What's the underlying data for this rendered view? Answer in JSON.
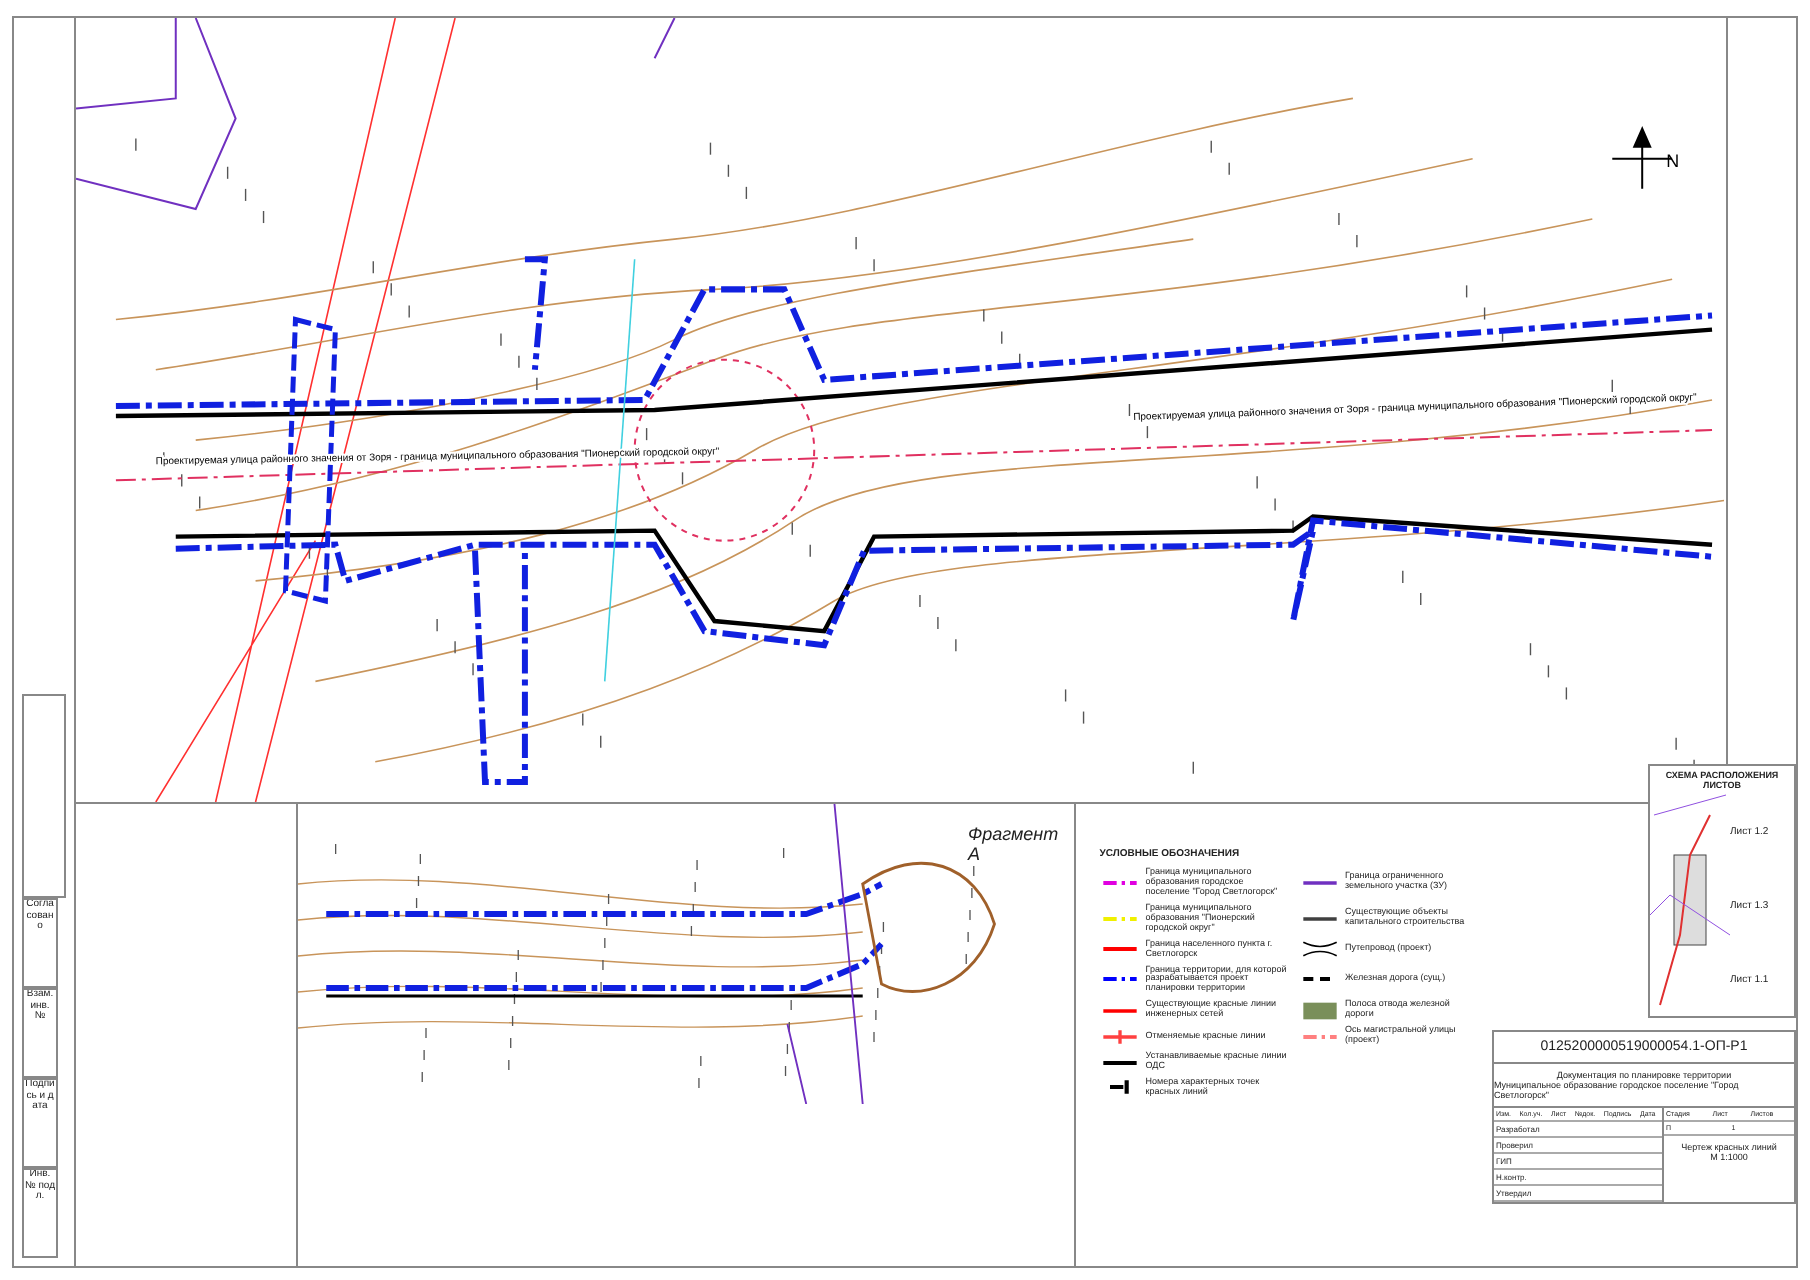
{
  "plan": {
    "north_label": "N",
    "street_label": "Проектируемая улица районного значения от Зоря - граница муниципального образования \"Пионерский городской округ\"",
    "street_label_left": "Проектируемая улица районного значения от Зоря - граница муниципального образования \"Пионерский городской округ\""
  },
  "fragment": {
    "title": "Фрагмент А"
  },
  "legend": {
    "title": "УСЛОВНЫЕ ОБОЗНАЧЕНИЯ",
    "items": [
      {
        "label": "Граница муниципального образования городское поселение \"Город Светлогорск\"",
        "kind": "dash",
        "color": "#e000e0"
      },
      {
        "label": "Граница муниципального образования \"Пионерский городской округ\"",
        "kind": "dash",
        "color": "#f0f000"
      },
      {
        "label": "Граница населенного пункта г. Светлогорск",
        "kind": "solid",
        "color": "#ff0000"
      },
      {
        "label": "Граница территории, для которой разрабатывается проект планировки территории",
        "kind": "dash",
        "color": "#0000ff"
      },
      {
        "label": "Существующие красные линии инженерных сетей",
        "kind": "thin",
        "color": "#ff0000"
      },
      {
        "label": "Отменяемые красные линии",
        "kind": "cross",
        "color": "#ff4040"
      },
      {
        "label": "Устанавливаемые красные линии ОДС",
        "kind": "solid",
        "color": "#000000"
      },
      {
        "label": "Номера характерных точек красных линий",
        "kind": "marker",
        "color": "#000000"
      },
      {
        "label": "Граница ограниченного земельного участка (ЗУ)",
        "kind": "thin",
        "color": "#7030c0"
      },
      {
        "label": "Существующие объекты капитального строительства",
        "kind": "thin",
        "color": "#404040"
      },
      {
        "label": "Путепровод (проект)",
        "kind": "bracket",
        "color": "#000000"
      },
      {
        "label": "Железная дорога (сущ.)",
        "kind": "rail",
        "color": "#000000"
      },
      {
        "label": "Полоса отвода железной дороги",
        "kind": "fill",
        "color": "#7a8f5a"
      },
      {
        "label": "Ось магистральной улицы (проект)",
        "kind": "dash",
        "color": "#ff8080"
      }
    ]
  },
  "scheme": {
    "title": "СХЕМА РАСПОЛОЖЕНИЯ ЛИСТОВ",
    "sheets": [
      "Лист 1.2",
      "Лист 1.3",
      "Лист 1.1"
    ]
  },
  "title_block": {
    "code": "0125200000519000054.1-ОП-Р1",
    "subtitle": "Документация по планировке территории",
    "municipality": "Муниципальное образование городское поселение \"Город Светлогорск\"",
    "headers": [
      "Изм.",
      "Кол.уч.",
      "Лист",
      "№док.",
      "Подпись",
      "Дата"
    ],
    "roles": [
      "Разработал",
      "Проверил",
      "ГИП",
      "Н.контр.",
      "Утвердил"
    ],
    "stage_headers": [
      "Стадия",
      "Лист",
      "Листов"
    ],
    "stage_values": [
      "П",
      "1"
    ],
    "drawing_name": "Чертеж красных линий",
    "scale": "М 1:1000"
  },
  "stamp": {
    "labels": [
      "Согласовано",
      "Взам. инв. №",
      "Подпись и дата",
      "Инв. № подл."
    ]
  }
}
